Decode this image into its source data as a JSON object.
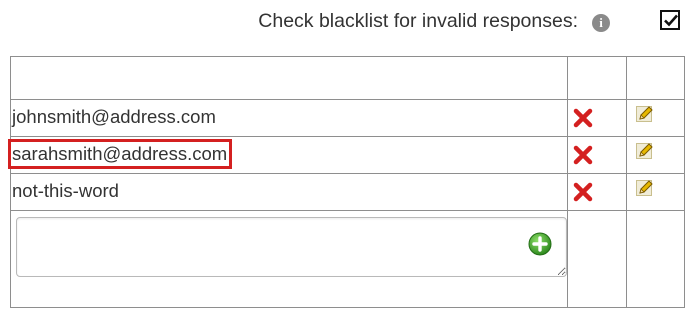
{
  "header": {
    "blacklist_label": "Check blacklist for invalid responses:",
    "info_icon": "info-icon",
    "blacklist_checked": true
  },
  "table": {
    "rows": [
      {
        "value": "johnsmith@address.com",
        "selected": false
      },
      {
        "value": "sarahsmith@address.com",
        "selected": true
      },
      {
        "value": "not-this-word",
        "selected": false
      }
    ],
    "new_entry": {
      "value": "",
      "placeholder": ""
    }
  },
  "icons": {
    "delete": "delete-icon",
    "edit": "edit-icon",
    "add": "add-icon"
  },
  "colors": {
    "delete": "#d42020",
    "add": "#3a9a2a",
    "selection": "#d42020"
  }
}
